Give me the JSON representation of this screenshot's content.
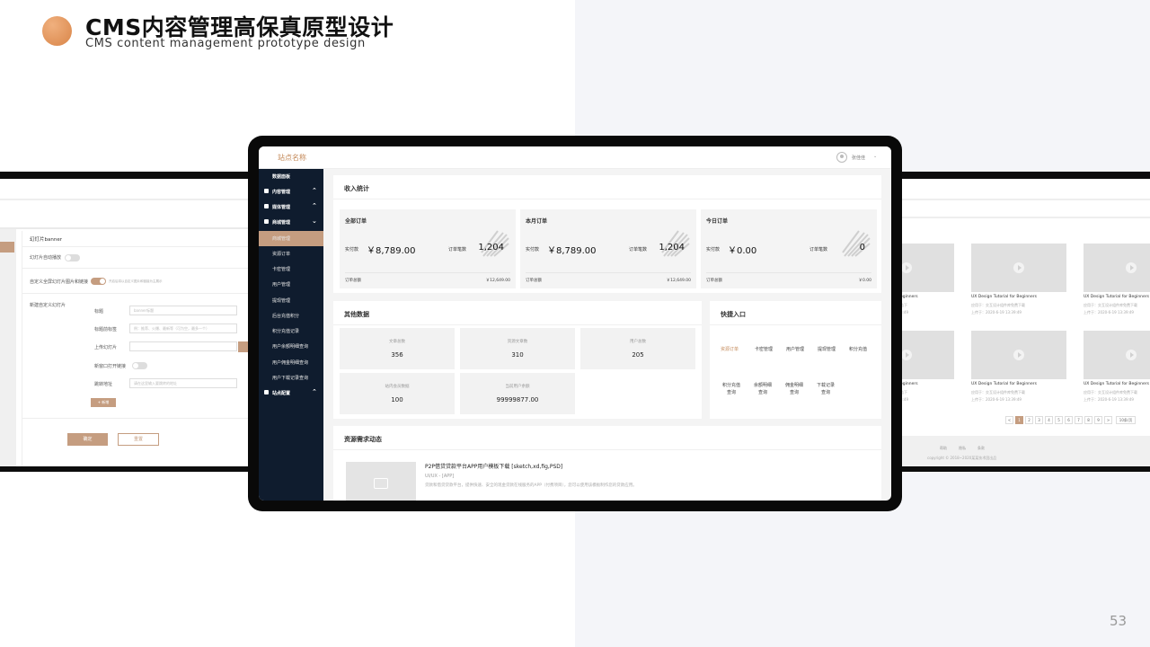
{
  "header": {
    "title": "CMS内容管理高保真原型设计",
    "subtitle": "CMS content management prototype design",
    "page_number": "53"
  },
  "app": {
    "site_name": "站点名称",
    "user_name": "张佳佳",
    "user_caret": "⌄"
  },
  "sidebar": {
    "items": [
      {
        "label": "数据面板"
      },
      {
        "label": "内容管理",
        "chevron": "⌃"
      },
      {
        "label": "媒体管理",
        "chevron": "⌃"
      },
      {
        "label": "商城管理",
        "chevron": "⌄"
      },
      {
        "label": "商城管理"
      },
      {
        "label": "资源订单"
      },
      {
        "label": "卡密管理"
      },
      {
        "label": "用户管理"
      },
      {
        "label": "提现管理"
      },
      {
        "label": "后台充值积分"
      },
      {
        "label": "积分充值记录"
      },
      {
        "label": "用户余额明细查询"
      },
      {
        "label": "用户佣金明细查询"
      },
      {
        "label": "用户下载记录查询"
      },
      {
        "label": "站点配置",
        "chevron": "⌃"
      }
    ]
  },
  "income": {
    "title": "收入统计",
    "cards": [
      {
        "title": "全部订单",
        "pay_label": "实付款",
        "pay_value": "￥8,789.00",
        "order_label": "订单笔数",
        "order_value": "1,204",
        "total_label": "订单总额",
        "total_value": "￥12,649.00"
      },
      {
        "title": "本月订单",
        "pay_label": "实付款",
        "pay_value": "￥8,789.00",
        "order_label": "订单笔数",
        "order_value": "1,204",
        "total_label": "订单总额",
        "total_value": "￥12,649.00"
      },
      {
        "title": "今日订单",
        "pay_label": "实付款",
        "pay_value": "￥0.00",
        "order_label": "订单笔数",
        "order_value": "0",
        "total_label": "订单总额",
        "total_value": "￥0.00"
      }
    ]
  },
  "other": {
    "title": "其他数据",
    "cards": [
      {
        "label": "文章总数",
        "value": "356"
      },
      {
        "label": "资源文章数",
        "value": "310"
      },
      {
        "label": "用户总数",
        "value": "205"
      },
      {
        "label": "站内会员数据",
        "value": "100"
      },
      {
        "label": "当前用户余额",
        "value": "99999877.00"
      }
    ]
  },
  "quick": {
    "title": "快捷入口",
    "links": [
      {
        "label": "资源订单"
      },
      {
        "label": "卡密管理"
      },
      {
        "label": "用户管理"
      },
      {
        "label": "提现管理"
      },
      {
        "label": "积分充值"
      },
      {
        "label": "积分充值\n查询"
      },
      {
        "label": "余额明细\n查询"
      },
      {
        "label": "佣金明细\n查询"
      },
      {
        "label": "下载记录\n查询"
      }
    ]
  },
  "resource": {
    "title": "资源需求动态",
    "item_title": "P2P借贷贷款平台APP用户模板下载 [sketch,xd,fig,PSD]",
    "item_tag": "UI/UX - [APP]",
    "item_desc": "贷款和借贷贷款平台，提供快速、安全的现金贷款在线服务的APP（付费项目），您可以使用该模板制作您的贷款应用。"
  },
  "left_screen": {
    "panel_title": "幻灯片banner",
    "autoplay_label": "幻灯片自动播放",
    "custom_label": "自定义全屏幻灯片图片和链接",
    "custom_hint": "开启后将以自定义图片和链接为主展示",
    "new_label": "新建自定义幻灯片",
    "fields": [
      {
        "label": "标题",
        "placeholder": "banner标题"
      },
      {
        "label": "标题前标签",
        "placeholder": "例：推荐、火爆、最新等（可为空，最多一个）"
      },
      {
        "label": "上传幻灯片",
        "placeholder": ""
      },
      {
        "label": "新窗口打开链接",
        "placeholder": ""
      },
      {
        "label": "跳转地址",
        "placeholder": "请在这里输入要跳转的地址"
      }
    ],
    "add_button": "+ 新增",
    "ok_button": "确定",
    "reset_button": "重置"
  },
  "right_screen": {
    "items": [
      {
        "title": "eginners",
        "meta": "若下",
        "date": "3:49"
      },
      {
        "title": "UX Design Tutorial for Beginners",
        "meta": "应用于：交互设计组件库免费下载",
        "date": "上传于：2020-6-19 13:39:49"
      },
      {
        "title": "UX Design Tutorial for Beginners",
        "meta": "应用于：交互设计组件库免费下载",
        "date": "上传于：2020-6-19 13:39:49"
      },
      {
        "title": "eginners",
        "meta": "若下",
        "date": "3:49"
      },
      {
        "title": "UX Design Tutorial for Beginners",
        "meta": "应用于：交互设计组件库免费下载",
        "date": "上传于：2020-6-19 13:39:49"
      },
      {
        "title": "UX Design Tutorial for Beginners",
        "meta": "应用于：交互设计组件库免费下载",
        "date": "上传于：2020-6-19 13:39:49"
      }
    ],
    "pagination": [
      "<",
      "1",
      "2",
      "3",
      "4",
      "5",
      "6",
      "7",
      "8",
      "9",
      ">"
    ],
    "page_size": "10条/页",
    "footer_links": [
      "帮助",
      "隐私",
      "条款"
    ],
    "copyright": "copyright © 2018~2020某某技术团出品"
  }
}
